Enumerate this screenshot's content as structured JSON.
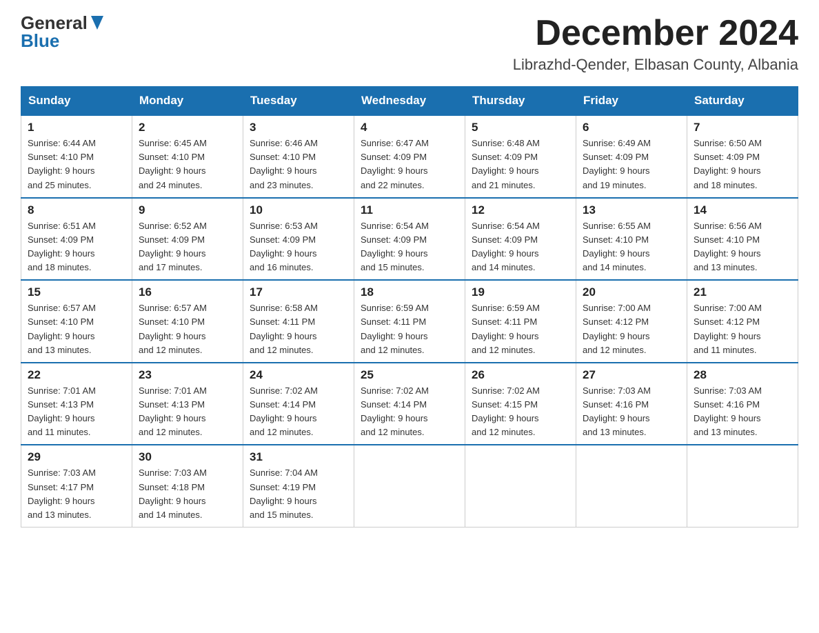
{
  "header": {
    "logo_general": "General",
    "logo_blue": "Blue",
    "month_title": "December 2024",
    "location": "Librazhd-Qender, Elbasan County, Albania"
  },
  "days_of_week": [
    "Sunday",
    "Monday",
    "Tuesday",
    "Wednesday",
    "Thursday",
    "Friday",
    "Saturday"
  ],
  "weeks": [
    [
      {
        "day": "1",
        "sunrise": "6:44 AM",
        "sunset": "4:10 PM",
        "daylight": "9 hours and 25 minutes."
      },
      {
        "day": "2",
        "sunrise": "6:45 AM",
        "sunset": "4:10 PM",
        "daylight": "9 hours and 24 minutes."
      },
      {
        "day": "3",
        "sunrise": "6:46 AM",
        "sunset": "4:10 PM",
        "daylight": "9 hours and 23 minutes."
      },
      {
        "day": "4",
        "sunrise": "6:47 AM",
        "sunset": "4:09 PM",
        "daylight": "9 hours and 22 minutes."
      },
      {
        "day": "5",
        "sunrise": "6:48 AM",
        "sunset": "4:09 PM",
        "daylight": "9 hours and 21 minutes."
      },
      {
        "day": "6",
        "sunrise": "6:49 AM",
        "sunset": "4:09 PM",
        "daylight": "9 hours and 19 minutes."
      },
      {
        "day": "7",
        "sunrise": "6:50 AM",
        "sunset": "4:09 PM",
        "daylight": "9 hours and 18 minutes."
      }
    ],
    [
      {
        "day": "8",
        "sunrise": "6:51 AM",
        "sunset": "4:09 PM",
        "daylight": "9 hours and 18 minutes."
      },
      {
        "day": "9",
        "sunrise": "6:52 AM",
        "sunset": "4:09 PM",
        "daylight": "9 hours and 17 minutes."
      },
      {
        "day": "10",
        "sunrise": "6:53 AM",
        "sunset": "4:09 PM",
        "daylight": "9 hours and 16 minutes."
      },
      {
        "day": "11",
        "sunrise": "6:54 AM",
        "sunset": "4:09 PM",
        "daylight": "9 hours and 15 minutes."
      },
      {
        "day": "12",
        "sunrise": "6:54 AM",
        "sunset": "4:09 PM",
        "daylight": "9 hours and 14 minutes."
      },
      {
        "day": "13",
        "sunrise": "6:55 AM",
        "sunset": "4:10 PM",
        "daylight": "9 hours and 14 minutes."
      },
      {
        "day": "14",
        "sunrise": "6:56 AM",
        "sunset": "4:10 PM",
        "daylight": "9 hours and 13 minutes."
      }
    ],
    [
      {
        "day": "15",
        "sunrise": "6:57 AM",
        "sunset": "4:10 PM",
        "daylight": "9 hours and 13 minutes."
      },
      {
        "day": "16",
        "sunrise": "6:57 AM",
        "sunset": "4:10 PM",
        "daylight": "9 hours and 12 minutes."
      },
      {
        "day": "17",
        "sunrise": "6:58 AM",
        "sunset": "4:11 PM",
        "daylight": "9 hours and 12 minutes."
      },
      {
        "day": "18",
        "sunrise": "6:59 AM",
        "sunset": "4:11 PM",
        "daylight": "9 hours and 12 minutes."
      },
      {
        "day": "19",
        "sunrise": "6:59 AM",
        "sunset": "4:11 PM",
        "daylight": "9 hours and 12 minutes."
      },
      {
        "day": "20",
        "sunrise": "7:00 AM",
        "sunset": "4:12 PM",
        "daylight": "9 hours and 12 minutes."
      },
      {
        "day": "21",
        "sunrise": "7:00 AM",
        "sunset": "4:12 PM",
        "daylight": "9 hours and 11 minutes."
      }
    ],
    [
      {
        "day": "22",
        "sunrise": "7:01 AM",
        "sunset": "4:13 PM",
        "daylight": "9 hours and 11 minutes."
      },
      {
        "day": "23",
        "sunrise": "7:01 AM",
        "sunset": "4:13 PM",
        "daylight": "9 hours and 12 minutes."
      },
      {
        "day": "24",
        "sunrise": "7:02 AM",
        "sunset": "4:14 PM",
        "daylight": "9 hours and 12 minutes."
      },
      {
        "day": "25",
        "sunrise": "7:02 AM",
        "sunset": "4:14 PM",
        "daylight": "9 hours and 12 minutes."
      },
      {
        "day": "26",
        "sunrise": "7:02 AM",
        "sunset": "4:15 PM",
        "daylight": "9 hours and 12 minutes."
      },
      {
        "day": "27",
        "sunrise": "7:03 AM",
        "sunset": "4:16 PM",
        "daylight": "9 hours and 13 minutes."
      },
      {
        "day": "28",
        "sunrise": "7:03 AM",
        "sunset": "4:16 PM",
        "daylight": "9 hours and 13 minutes."
      }
    ],
    [
      {
        "day": "29",
        "sunrise": "7:03 AM",
        "sunset": "4:17 PM",
        "daylight": "9 hours and 13 minutes."
      },
      {
        "day": "30",
        "sunrise": "7:03 AM",
        "sunset": "4:18 PM",
        "daylight": "9 hours and 14 minutes."
      },
      {
        "day": "31",
        "sunrise": "7:04 AM",
        "sunset": "4:19 PM",
        "daylight": "9 hours and 15 minutes."
      },
      null,
      null,
      null,
      null
    ]
  ],
  "labels": {
    "sunrise": "Sunrise:",
    "sunset": "Sunset:",
    "daylight": "Daylight:"
  }
}
